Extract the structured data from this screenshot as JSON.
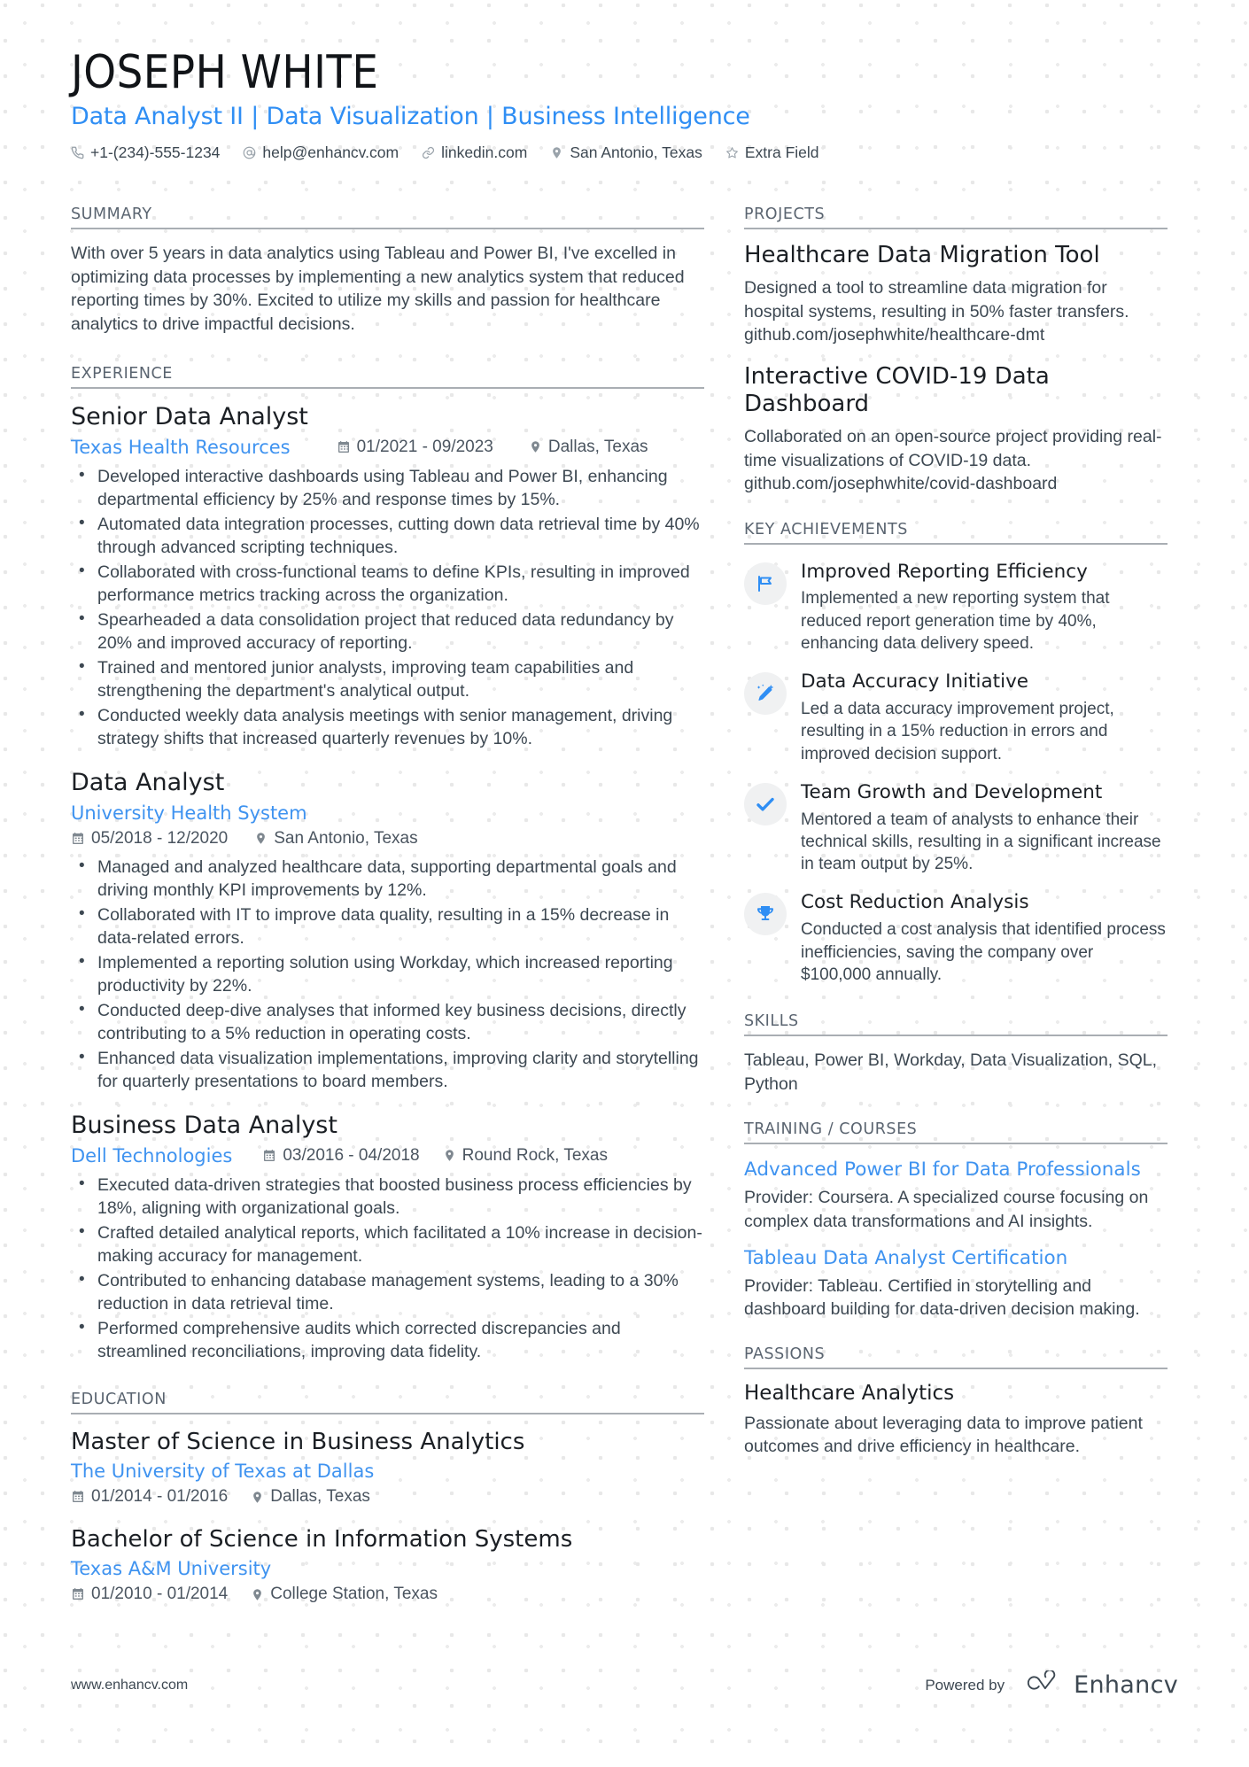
{
  "header": {
    "name": "JOSEPH WHITE",
    "headline": "Data Analyst II | Data Visualization | Business Intelligence",
    "contacts": [
      {
        "icon": "phone-icon",
        "text": "+1-(234)-555-1234"
      },
      {
        "icon": "email-icon",
        "text": "help@enhancv.com"
      },
      {
        "icon": "link-icon",
        "text": "linkedin.com"
      },
      {
        "icon": "location-icon",
        "text": "San Antonio, Texas"
      },
      {
        "icon": "star-icon",
        "text": "Extra Field"
      }
    ]
  },
  "sections": {
    "summary_title": "SUMMARY",
    "experience_title": "EXPERIENCE",
    "education_title": "EDUCATION",
    "projects_title": "PROJECTS",
    "achievements_title": "KEY ACHIEVEMENTS",
    "skills_title": "SKILLS",
    "training_title": "TRAINING / COURSES",
    "passions_title": "PASSIONS"
  },
  "summary": {
    "text": "With over 5 years in data analytics using Tableau and Power BI, I've excelled in optimizing data processes by implementing a new analytics system that reduced reporting times by 30%. Excited to utilize my skills and passion for healthcare analytics to drive impactful decisions."
  },
  "experience": [
    {
      "title": "Senior Data Analyst",
      "company": "Texas Health Resources",
      "dates": "01/2021 - 09/2023",
      "location": "Dallas, Texas",
      "bullets": [
        "Developed interactive dashboards using Tableau and Power BI, enhancing departmental efficiency by 25% and response times by 15%.",
        "Automated data integration processes, cutting down data retrieval time by 40% through advanced scripting techniques.",
        "Collaborated with cross-functional teams to define KPIs, resulting in improved performance metrics tracking across the organization.",
        "Spearheaded a data consolidation project that reduced data redundancy by 20% and improved accuracy of reporting.",
        "Trained and mentored junior analysts, improving team capabilities and strengthening the department's analytical output.",
        "Conducted weekly data analysis meetings with senior management, driving strategy shifts that increased quarterly revenues by 10%."
      ]
    },
    {
      "title": "Data Analyst",
      "company": "University Health System",
      "dates": "05/2018 - 12/2020",
      "location": "San Antonio, Texas",
      "bullets": [
        "Managed and analyzed healthcare data, supporting departmental goals and driving monthly KPI improvements by 12%.",
        "Collaborated with IT to improve data quality, resulting in a 15% decrease in data-related errors.",
        "Implemented a reporting solution using Workday, which increased reporting productivity by 22%.",
        "Conducted deep-dive analyses that informed key business decisions, directly contributing to a 5% reduction in operating costs.",
        "Enhanced data visualization implementations, improving clarity and storytelling for quarterly presentations to board members."
      ]
    },
    {
      "title": "Business Data Analyst",
      "company": "Dell Technologies",
      "dates": "03/2016 - 04/2018",
      "location": "Round Rock, Texas",
      "bullets": [
        "Executed data-driven strategies that boosted business process efficiencies by 18%, aligning with organizational goals.",
        "Crafted detailed analytical reports, which facilitated a 10% increase in decision-making accuracy for management.",
        "Contributed to enhancing database management systems, leading to a 30% reduction in data retrieval time.",
        "Performed comprehensive audits which corrected discrepancies and streamlined reconciliations, improving data fidelity."
      ]
    }
  ],
  "education": [
    {
      "degree": "Master of Science in Business Analytics",
      "school": "The University of Texas at Dallas",
      "dates": "01/2014 - 01/2016",
      "location": "Dallas, Texas"
    },
    {
      "degree": "Bachelor of Science in Information Systems",
      "school": "Texas A&M University",
      "dates": "01/2010 - 01/2014",
      "location": "College Station, Texas"
    }
  ],
  "projects": [
    {
      "title": "Healthcare Data Migration Tool",
      "description": "Designed a tool to streamline data migration for hospital systems, resulting in 50% faster transfers. github.com/josephwhite/healthcare-dmt"
    },
    {
      "title": "Interactive COVID-19 Data Dashboard",
      "description": "Collaborated on an open-source project providing real-time visualizations of COVID-19 data. github.com/josephwhite/covid-dashboard"
    }
  ],
  "achievements": [
    {
      "icon": "flag-icon",
      "title": "Improved Reporting Efficiency",
      "description": "Implemented a new reporting system that reduced report generation time by 40%, enhancing data delivery speed."
    },
    {
      "icon": "magic-wand-icon",
      "title": "Data Accuracy Initiative",
      "description": "Led a data accuracy improvement project, resulting in a 15% reduction in errors and improved decision support."
    },
    {
      "icon": "check-icon",
      "title": "Team Growth and Development",
      "description": "Mentored a team of analysts to enhance their technical skills, resulting in a significant increase in team output by 25%."
    },
    {
      "icon": "trophy-icon",
      "title": "Cost Reduction Analysis",
      "description": "Conducted a cost analysis that identified process inefficiencies, saving the company over $100,000 annually."
    }
  ],
  "skills": {
    "text": "Tableau, Power BI, Workday, Data Visualization, SQL, Python"
  },
  "training": [
    {
      "title": "Advanced Power BI for Data Professionals",
      "description": "Provider: Coursera. A specialized course focusing on complex data transformations and AI insights."
    },
    {
      "title": "Tableau Data Analyst Certification",
      "description": "Provider: Tableau. Certified in storytelling and dashboard building for data-driven decision making."
    }
  ],
  "passions": [
    {
      "title": "Healthcare Analytics",
      "description": "Passionate about leveraging data to improve patient outcomes and drive efficiency in healthcare."
    }
  ],
  "footer": {
    "url": "www.enhancv.com",
    "powered_label": "Powered by",
    "brand": "Enhancv"
  },
  "colors": {
    "accent": "#3f93f0",
    "headline": "#2f8ef4",
    "text": "#3d4852",
    "heading": "#5a6470",
    "badge_bg": "#f0f1f2"
  }
}
